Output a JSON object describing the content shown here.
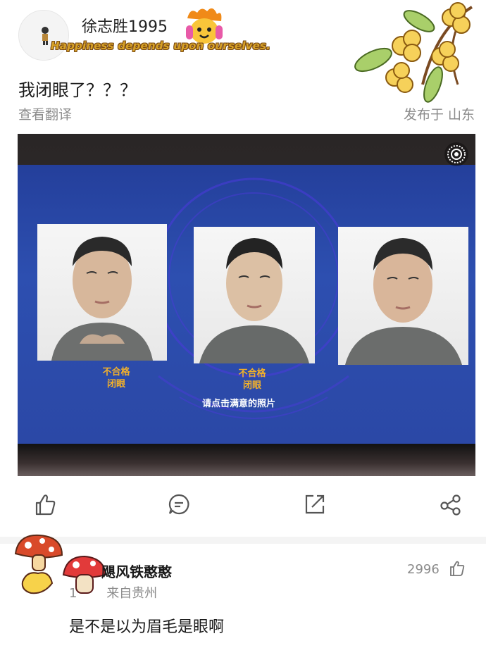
{
  "header": {
    "username": "徐志胜1995",
    "motto": "Happiness depends upon ourselves."
  },
  "post": {
    "text": "我闭眼了？？？",
    "translate_label": "查看翻译",
    "location": "发布于 山东"
  },
  "photo": {
    "cards": [
      {
        "status": "不合格",
        "reason": "闭眼"
      },
      {
        "status": "不合格",
        "reason": "闭眼"
      },
      {
        "status": "",
        "reason": ""
      }
    ],
    "prompt": "请点击满意的照片"
  },
  "actions": [
    "like-icon",
    "comment-icon",
    "share-icon",
    "more-icon"
  ],
  "comment": {
    "author": "飓风铁憨憨",
    "date": "1",
    "source": "来自贵州",
    "likes": "2996",
    "text": "是不是以为眉毛是眼啊"
  },
  "colors": {
    "accent_gold": "#f3b12a",
    "screen_blue": "#2d4fb0",
    "meta_gray": "#8b8b8b"
  }
}
